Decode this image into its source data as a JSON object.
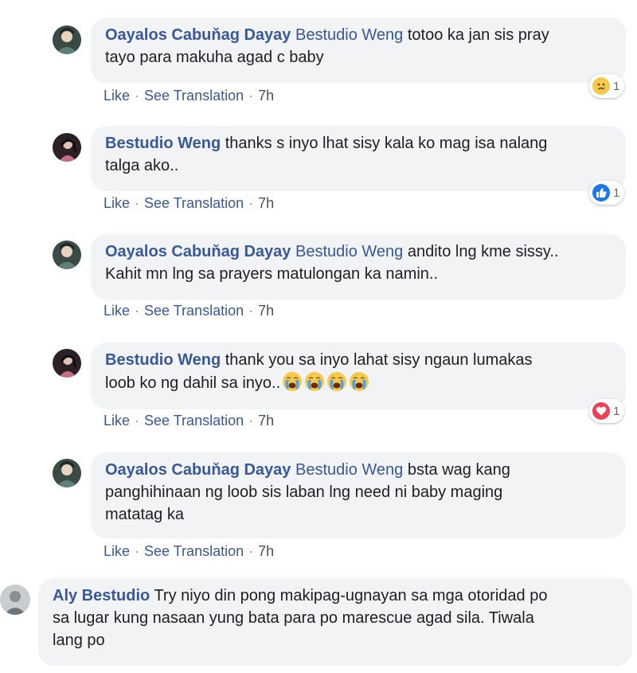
{
  "comments": [
    {
      "author": "Oayalos Cabuňag Dayay",
      "mention": "Bestudio Weng",
      "text_line1": " totoo ka jan sis pray",
      "text_line2": "tayo para makuha agad c baby",
      "actions": {
        "like": "Like",
        "translate": "See Translation",
        "time": "7h"
      },
      "reaction": {
        "type": "sad-icon",
        "count": "1"
      }
    },
    {
      "author": "Bestudio Weng",
      "text_line1": " thanks s inyo lhat sisy kala ko mag isa nalang",
      "text_line2": "talga ako..",
      "actions": {
        "like": "Like",
        "translate": "See Translation",
        "time": "7h"
      },
      "reaction": {
        "type": "thumbs-up-icon",
        "count": "1",
        "color": "#1877f2"
      }
    },
    {
      "author": "Oayalos Cabuňag Dayay",
      "mention": "Bestudio Weng",
      "text_line1": " andito lng kme sissy..",
      "text_line2": "Kahit mn lng sa prayers matulongan ka namin..",
      "actions": {
        "like": "Like",
        "translate": "See Translation",
        "time": "7h"
      }
    },
    {
      "author": "Bestudio Weng",
      "text_line1": " thank you sa inyo lahat sisy ngaun lumakas",
      "text_line2": "loob ko ng dahil sa inyo..",
      "emojis": [
        "crying-face-icon",
        "crying-face-icon",
        "crying-face-icon",
        "crying-face-icon"
      ],
      "actions": {
        "like": "Like",
        "translate": "See Translation",
        "time": "7h"
      },
      "reaction": {
        "type": "heart-icon",
        "count": "1",
        "color": "#f33e58"
      }
    },
    {
      "author": "Oayalos Cabuňag Dayay",
      "mention": "Bestudio Weng",
      "text_line1": " bsta wag kang",
      "text_line2": "panghihinaan ng loob sis laban lng need ni baby maging",
      "text_line3": "matatag ka",
      "actions": {
        "like": "Like",
        "translate": "See Translation",
        "time": "7h"
      }
    },
    {
      "author": "Aly Bestudio",
      "text_line1": " Try niyo din pong makipag-ugnayan sa mga otoridad po",
      "text_line2": "sa lugar kung nasaan yung bata para po marescue agad sila. Tiwala",
      "text_line3": "lang po"
    }
  ],
  "colors": {
    "link": "#385898",
    "bubble": "#f2f3f5",
    "text": "#1c1e21",
    "like_blue": "#1877f2",
    "love_red": "#f33e58",
    "sad_yellow": "#f7c94b"
  }
}
